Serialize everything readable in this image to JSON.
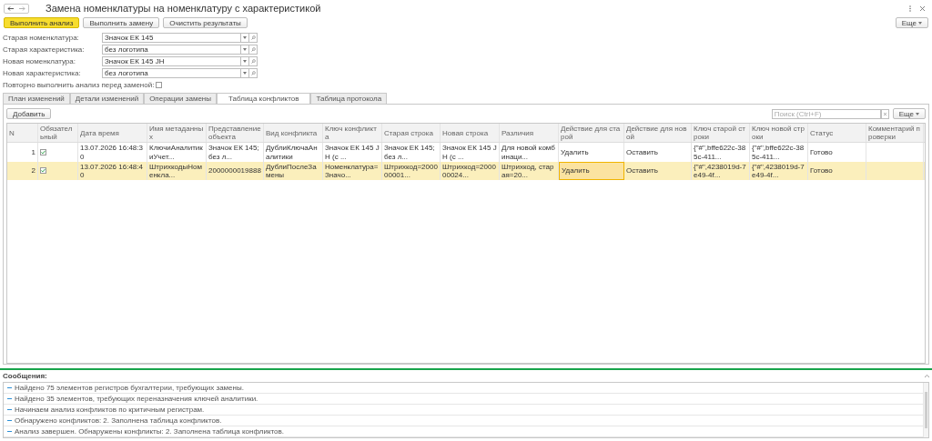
{
  "window": {
    "title": "Замена номенклатуры на номенклатуру с характеристикой"
  },
  "toolbar": {
    "buttons": [
      {
        "label": "Выполнить анализ",
        "primary": true
      },
      {
        "label": "Выполнить замену",
        "primary": false
      },
      {
        "label": "Очистить результаты",
        "primary": false
      }
    ],
    "more": "Еще"
  },
  "fields": [
    {
      "label": "Старая номенклатура:",
      "value": "Значок ЕК 145"
    },
    {
      "label": "Старая характеристика:",
      "value": "без логотипа"
    },
    {
      "label": "Новая номенклатура:",
      "value": "Значок ЕК 145 JH"
    },
    {
      "label": "Новая характеристика:",
      "value": "без логотипа"
    }
  ],
  "reanalyze": {
    "label": "Повторно выполнить анализ перед заменой:",
    "checked": false
  },
  "tabs": [
    {
      "label": "План изменений",
      "selected": false
    },
    {
      "label": "Детали изменений",
      "selected": false
    },
    {
      "label": "Операции замены",
      "selected": false
    },
    {
      "label": "Таблица конфликтов",
      "selected": true
    },
    {
      "label": "Таблица протокола",
      "selected": false
    }
  ],
  "table_toolbar": {
    "add_button": "Добавить",
    "search": {
      "placeholder": "Поиск (Ctrl+F)"
    },
    "more": "Еще"
  },
  "table": {
    "columns": [
      {
        "label": "N",
        "kind": "number"
      },
      {
        "label": "Обязательный",
        "kind": "check"
      },
      {
        "label": "Дата время",
        "kind": "text"
      },
      {
        "label": "Имя метаданных",
        "kind": "text"
      },
      {
        "label": "Представление объекта",
        "kind": "text"
      },
      {
        "label": "Вид конфликта",
        "kind": "text"
      },
      {
        "label": "Ключ конфликта",
        "kind": "text"
      },
      {
        "label": "Старая строка",
        "kind": "text"
      },
      {
        "label": "Новая строка",
        "kind": "text"
      },
      {
        "label": "Различия",
        "kind": "text"
      },
      {
        "label": "Действие для старой",
        "kind": "text"
      },
      {
        "label": "Действие для новой",
        "kind": "text"
      },
      {
        "label": "Ключ старой строки",
        "kind": "text"
      },
      {
        "label": "Ключ новой строки",
        "kind": "text"
      },
      {
        "label": "Статус",
        "kind": "text"
      },
      {
        "label": "Комментарий проверки",
        "kind": "text"
      }
    ],
    "rows": [
      {
        "selected": false,
        "cells": [
          {
            "text": "1",
            "focused": false
          },
          {
            "checked": true
          },
          {
            "text": "13.07.2026 16:48:30",
            "focused": false
          },
          {
            "text": "КлючиАналитикиУчет...",
            "focused": false
          },
          {
            "text": "Значок ЕК 145; без л...",
            "focused": false
          },
          {
            "text": "ДублиКлючаАналитики",
            "focused": false
          },
          {
            "text": "Значок ЕК 145 JH (с ...",
            "focused": false
          },
          {
            "text": "Значок ЕК 145; без л...",
            "focused": false
          },
          {
            "text": "Значок ЕК 145 JH (с ...",
            "focused": false
          },
          {
            "text": "Для новой комбинаци...",
            "focused": false
          },
          {
            "text": "Удалить",
            "focused": false
          },
          {
            "text": "Оставить",
            "focused": false
          },
          {
            "text": "{\"#\",bffe622c-385c-411...",
            "focused": false
          },
          {
            "text": "{\"#\",bffe622c-385c-411...",
            "focused": false
          },
          {
            "text": "Готово",
            "focused": false
          }
        ]
      },
      {
        "selected": true,
        "cells": [
          {
            "text": "2",
            "focused": false
          },
          {
            "checked": true
          },
          {
            "text": "13.07.2026 16:48:40",
            "focused": false
          },
          {
            "text": "ШтрихкодыНоменкла...",
            "focused": false
          },
          {
            "text": "2000000019888",
            "focused": false
          },
          {
            "text": "ДублиПослеЗамены",
            "focused": false
          },
          {
            "text": "Номенклатура=Значо...",
            "focused": false
          },
          {
            "text": "Штрихкод=200000001...",
            "focused": false
          },
          {
            "text": "Штрихкод=200000024...",
            "focused": false
          },
          {
            "text": "Штрихкод, старая=20...",
            "focused": false
          },
          {
            "text": "Удалить",
            "focused": true
          },
          {
            "text": "Оставить",
            "focused": false
          },
          {
            "text": "{\"#\",4238019d-7e49-4f...",
            "focused": false
          },
          {
            "text": "{\"#\",4238019d-7e49-4f...",
            "focused": false
          },
          {
            "text": "Готово",
            "focused": false
          }
        ]
      }
    ]
  },
  "messages": {
    "title": "Сообщения:",
    "items": [
      "Найдено 75 элементов регистров бухгалтерии, требующих замены.",
      "Найдено 35 элементов, требующих переназначения ключей аналитики.",
      "Начинаем анализ конфликтов по критичным регистрам.",
      "Обнаружено конфликтов: 2. Заполнена таблица конфликтов.",
      "Анализ завершен. Обнаружены конфликты: 2. Заполнена таблица конфликтов."
    ]
  }
}
